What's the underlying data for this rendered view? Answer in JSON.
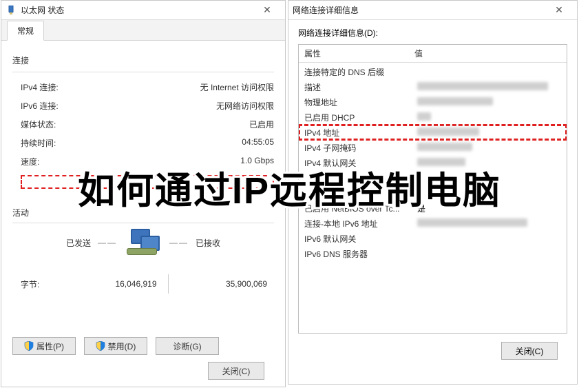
{
  "left": {
    "title": "以太网 状态",
    "tab": "常规",
    "section_conn": "连接",
    "ipv4_label": "IPv4 连接:",
    "ipv4_value": "无 Internet 访问权限",
    "ipv6_label": "IPv6 连接:",
    "ipv6_value": "无网络访问权限",
    "media_label": "媒体状态:",
    "media_value": "已启用",
    "duration_label": "持续时间:",
    "duration_value": "04:55:05",
    "speed_label": "速度:",
    "speed_value": "1.0 Gbps",
    "section_activity": "活动",
    "sent_label": "已发送",
    "recv_label": "已接收",
    "bytes_label": "字节:",
    "bytes_sent": "16,046,919",
    "bytes_recv": "35,900,069",
    "btn_props": "属性(P)",
    "btn_disable": "禁用(D)",
    "btn_diag": "诊断(G)",
    "btn_close": "关闭(C)"
  },
  "right": {
    "title": "网络连接详细信息",
    "details_label": "网络连接详细信息(D):",
    "hdr_prop": "属性",
    "hdr_val": "值",
    "rows": [
      "连接特定的 DNS 后缀",
      "描述",
      "物理地址",
      "已启用 DHCP",
      "IPv4 地址",
      "IPv4 子网掩码",
      "IPv4 默认网关",
      "",
      "",
      "已启用 NetBIOS over Tc...",
      "连接-本地 IPv6 地址",
      "IPv6 默认网关",
      "IPv6 DNS 服务器"
    ],
    "netbios_suffix": "是",
    "btn_close": "关闭(C)"
  },
  "banner": "如何通过IP远程控制电脑"
}
